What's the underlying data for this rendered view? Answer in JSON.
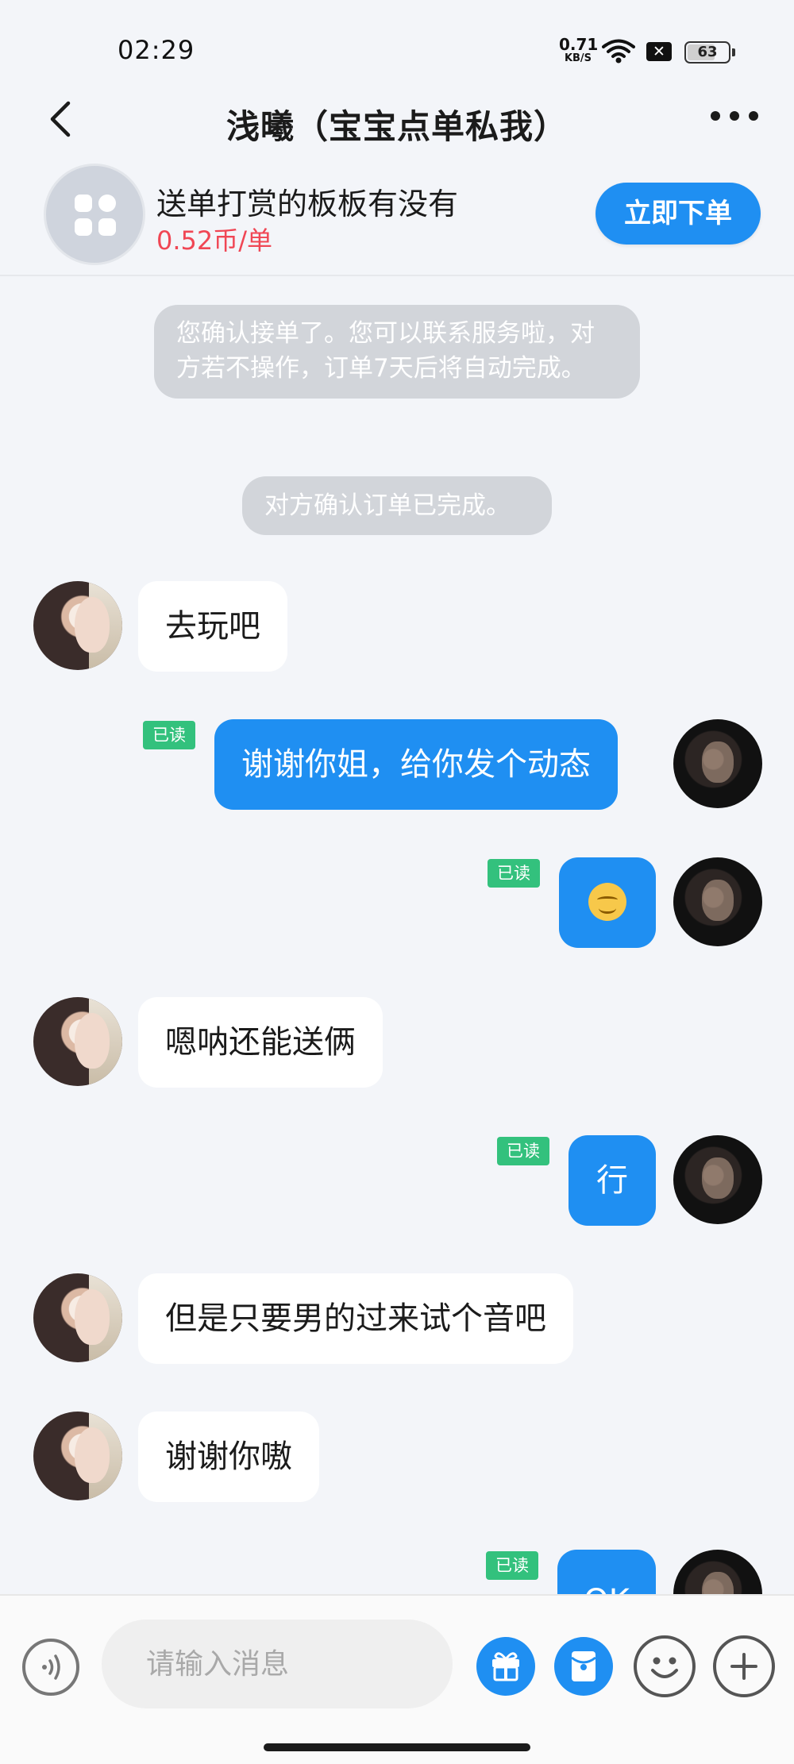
{
  "status_bar": {
    "time": "02:29",
    "net_speed_value": "0.71",
    "net_speed_unit": "KB/S",
    "sim_status": "✕",
    "battery_level": "63"
  },
  "header": {
    "title": "浅曦（宝宝点单私我）"
  },
  "order": {
    "name": "送单打赏的板板有没有",
    "price": "0.52币/单",
    "button_label": "立即下单"
  },
  "system_messages": [
    "您确认接单了。您可以联系服务啦，对方若不操作，订单7天后将自动完成。",
    "对方确认订单已完成。"
  ],
  "messages": [
    {
      "from": "other",
      "text": "去玩吧"
    },
    {
      "from": "me",
      "text": "谢谢你姐，给你发个动态",
      "status": "已读"
    },
    {
      "from": "me",
      "emoji": "smiling-face",
      "status": "已读"
    },
    {
      "from": "other",
      "text": "嗯呐还能送俩"
    },
    {
      "from": "me",
      "text": "行",
      "status": "已读"
    },
    {
      "from": "other",
      "text": "但是只要男的过来试个音吧"
    },
    {
      "from": "other",
      "text": "谢谢你嗷"
    },
    {
      "from": "me",
      "text": "OK",
      "status": "已读"
    }
  ],
  "input": {
    "placeholder": "请输入消息"
  },
  "colors": {
    "accent": "#1f8ff2",
    "price": "#f04654",
    "read_badge": "#33c17d",
    "background": "#f3f5f9"
  }
}
